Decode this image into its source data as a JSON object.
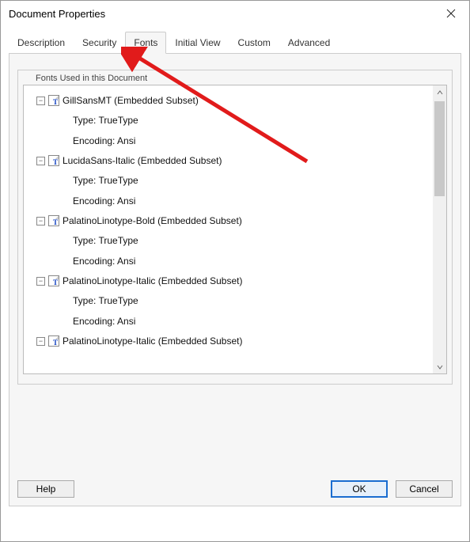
{
  "window": {
    "title": "Document Properties"
  },
  "tabs": {
    "items": [
      "Description",
      "Security",
      "Fonts",
      "Initial View",
      "Custom",
      "Advanced"
    ],
    "active_index": 2
  },
  "fonts_panel": {
    "group_label": "Fonts Used in this Document",
    "fonts": [
      {
        "name": "GillSansMT (Embedded Subset)",
        "type_label": "Type: TrueType",
        "encoding_label": "Encoding: Ansi",
        "expanded": true
      },
      {
        "name": "LucidaSans-Italic (Embedded Subset)",
        "type_label": "Type: TrueType",
        "encoding_label": "Encoding: Ansi",
        "expanded": true
      },
      {
        "name": "PalatinoLinotype-Bold (Embedded Subset)",
        "type_label": "Type: TrueType",
        "encoding_label": "Encoding: Ansi",
        "expanded": true
      },
      {
        "name": "PalatinoLinotype-Italic (Embedded Subset)",
        "type_label": "Type: TrueType",
        "encoding_label": "Encoding: Ansi",
        "expanded": true
      },
      {
        "name": "PalatinoLinotype-Italic (Embedded Subset)",
        "type_label": "",
        "encoding_label": "",
        "expanded": false
      }
    ]
  },
  "buttons": {
    "help": "Help",
    "ok": "OK",
    "cancel": "Cancel"
  },
  "annotation": {
    "arrow_color": "#e11b1b"
  }
}
